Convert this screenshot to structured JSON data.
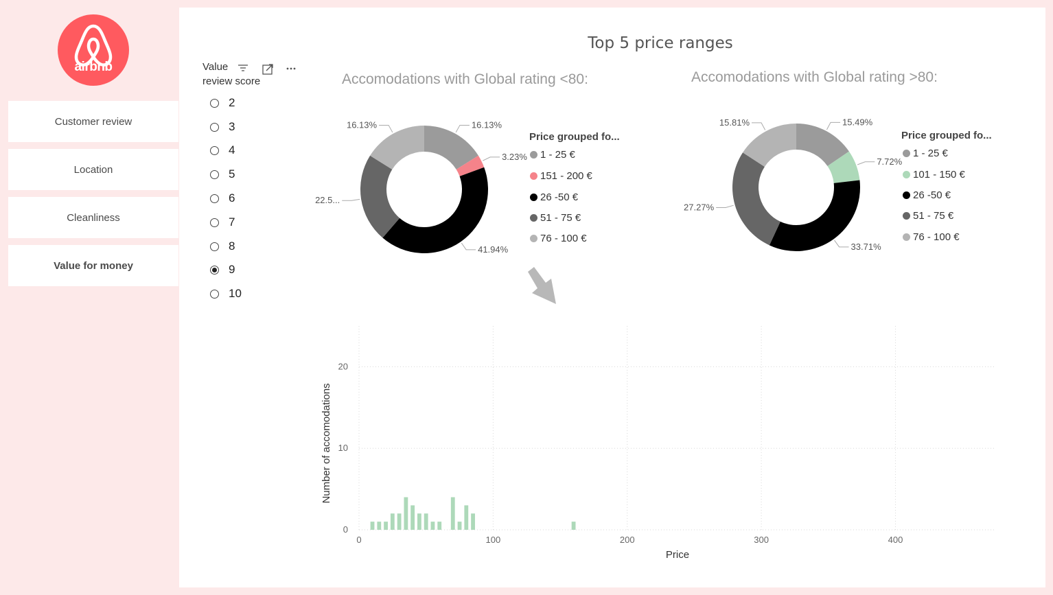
{
  "logo": {
    "text": "airbnb",
    "color": "#ff5a5f"
  },
  "nav": {
    "items": [
      {
        "label": "Customer review",
        "active": false
      },
      {
        "label": "Location",
        "active": false
      },
      {
        "label": "Cleanliness",
        "active": false
      },
      {
        "label": "Value for money",
        "active": true
      }
    ]
  },
  "slicer": {
    "title_line1": "Value",
    "title_line2": "review score",
    "options": [
      "2",
      "3",
      "4",
      "5",
      "6",
      "7",
      "8",
      "9",
      "10"
    ],
    "selected": "9",
    "icons": [
      "filter-icon",
      "focus-mode-icon",
      "more-options-icon"
    ]
  },
  "page_title": "Top 5 price ranges",
  "donut_left": {
    "subtitle": "Accomodations with Global rating <80:",
    "legend_title": "Price  grouped fo...",
    "legend": [
      {
        "label": "1 - 25 €",
        "color": "#9b9b9b"
      },
      {
        "label": "151 - 200 €",
        "color": "#f5838a"
      },
      {
        "label": "26 -50 €",
        "color": "#000000"
      },
      {
        "label": "51 - 75 €",
        "color": "#666666"
      },
      {
        "label": "76 - 100 €",
        "color": "#b4b4b4"
      }
    ]
  },
  "donut_right": {
    "subtitle": "Accomodations with Global rating >80:",
    "legend_title": "Price  grouped fo...",
    "legend": [
      {
        "label": "1 - 25 €",
        "color": "#9b9b9b"
      },
      {
        "label": "101 - 150 €",
        "color": "#add9b9"
      },
      {
        "label": "26 -50 €",
        "color": "#000000"
      },
      {
        "label": "51 - 75 €",
        "color": "#666666"
      },
      {
        "label": "76 - 100 €",
        "color": "#b4b4b4"
      }
    ]
  },
  "chart_data": [
    {
      "type": "pie",
      "title": "Accomodations with Global rating <80:",
      "legend_title": "Price  grouped fo...",
      "donut": true,
      "slices": [
        {
          "label": "1 - 25 €",
          "value": 16.13,
          "display": "16.13%",
          "color": "#9b9b9b"
        },
        {
          "label": "151 - 200 €",
          "value": 3.23,
          "display": "3.23%",
          "color": "#f5838a"
        },
        {
          "label": "26 -50 €",
          "value": 41.94,
          "display": "41.94%",
          "color": "#000000"
        },
        {
          "label": "51 - 75 €",
          "value": 22.58,
          "display": "22.5...",
          "color": "#666666"
        },
        {
          "label": "76 - 100 €",
          "value": 16.13,
          "display": "16.13%",
          "color": "#b4b4b4"
        }
      ]
    },
    {
      "type": "pie",
      "title": "Accomodations with Global rating >80:",
      "legend_title": "Price  grouped fo...",
      "donut": true,
      "slices": [
        {
          "label": "1 - 25 €",
          "value": 15.49,
          "display": "15.49%",
          "color": "#9b9b9b"
        },
        {
          "label": "101 - 150 €",
          "value": 7.72,
          "display": "7.72%",
          "color": "#add9b9"
        },
        {
          "label": "26 -50 €",
          "value": 33.71,
          "display": "33.71%",
          "color": "#000000"
        },
        {
          "label": "51 - 75 €",
          "value": 27.27,
          "display": "27.27%",
          "color": "#666666"
        },
        {
          "label": "76 - 100 €",
          "value": 15.81,
          "display": "15.81%",
          "color": "#b4b4b4"
        }
      ]
    },
    {
      "type": "bar",
      "xlabel": "Price",
      "ylabel": "Number of accomodations",
      "xlim": [
        0,
        475
      ],
      "ylim": [
        0,
        25
      ],
      "xticks": [
        0,
        100,
        200,
        300,
        400
      ],
      "yticks": [
        0,
        10,
        20
      ],
      "grid": true,
      "bar_color": "#add9b9",
      "bar_width": 4,
      "x": [
        10,
        15,
        20,
        25,
        30,
        35,
        40,
        45,
        50,
        55,
        60,
        70,
        75,
        80,
        85,
        160
      ],
      "values": [
        1,
        1,
        1,
        2,
        2,
        4,
        3,
        2,
        2,
        1,
        1,
        4,
        1,
        3,
        2,
        1
      ]
    }
  ]
}
